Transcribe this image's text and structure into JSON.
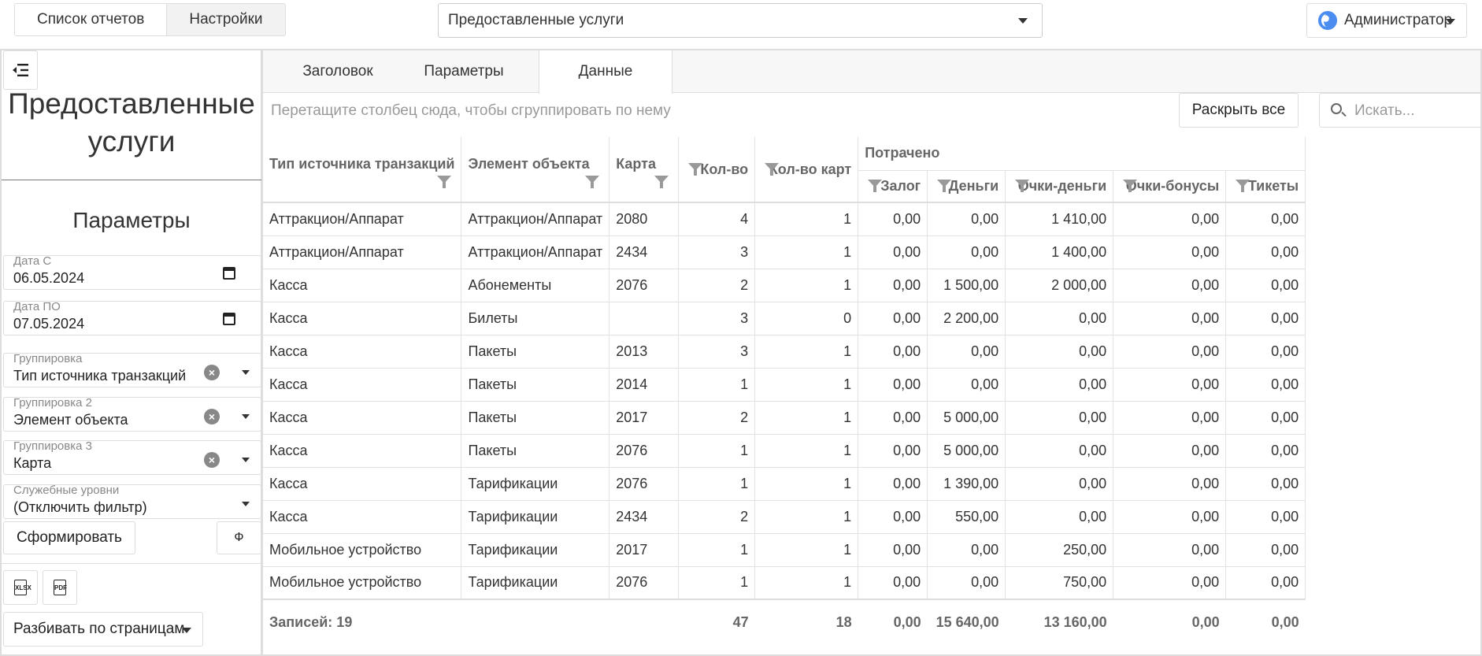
{
  "top": {
    "tabs": [
      "Список отчетов",
      "Настройки"
    ],
    "report_select": "Предоставленные услуги",
    "user": "Администратор"
  },
  "left": {
    "title": "Предоставленные услуги",
    "params_heading": "Параметры",
    "date_from": {
      "label": "Дата С",
      "value": "06.05.2024"
    },
    "date_to": {
      "label": "Дата ПО",
      "value": "07.05.2024"
    },
    "group1": {
      "label": "Группировка",
      "value": "Тип источника транзакций"
    },
    "group2": {
      "label": "Группировка 2",
      "value": "Элемент объекта"
    },
    "group3": {
      "label": "Группировка 3",
      "value": "Карта"
    },
    "service": {
      "label": "Служебные уровни",
      "value": "(Отключить фильтр)"
    },
    "generate": "Сформировать",
    "f_button": "Ф",
    "xlsx_icon": "xlsx-file-icon",
    "pdf_icon": "pdf-file-icon",
    "paging": "Разбивать по страницам"
  },
  "right": {
    "tabs": [
      "Заголовок",
      "Параметры",
      "Данные"
    ],
    "group_hint": "Перетащите столбец сюда, чтобы сгруппировать по нему",
    "expand_all": "Раскрыть все",
    "search_placeholder": "Искать...",
    "columns": {
      "source": "Тип источника транзакций",
      "element": "Элемент объекта",
      "card": "Карта",
      "qty": "Кол-во",
      "cards": "Кол-во карт",
      "spent": "Потрачено",
      "deposit": "Залог",
      "money": "Деньги",
      "pmoney": "Очки-деньги",
      "pbonus": "Очки-бонусы",
      "tickets": "Тикеты"
    },
    "rows": [
      [
        "Аттракцион/Аппарат",
        "Аттракцион/Аппарат",
        "2080",
        "4",
        "1",
        "0,00",
        "0,00",
        "1 410,00",
        "0,00",
        "0,00"
      ],
      [
        "Аттракцион/Аппарат",
        "Аттракцион/Аппарат",
        "2434",
        "3",
        "1",
        "0,00",
        "0,00",
        "1 400,00",
        "0,00",
        "0,00"
      ],
      [
        "Касса",
        "Абонементы",
        "2076",
        "2",
        "1",
        "0,00",
        "1 500,00",
        "2 000,00",
        "0,00",
        "0,00"
      ],
      [
        "Касса",
        "Билеты",
        "",
        "3",
        "0",
        "0,00",
        "2 200,00",
        "0,00",
        "0,00",
        "0,00"
      ],
      [
        "Касса",
        "Пакеты",
        "2013",
        "3",
        "1",
        "0,00",
        "0,00",
        "0,00",
        "0,00",
        "0,00"
      ],
      [
        "Касса",
        "Пакеты",
        "2014",
        "1",
        "1",
        "0,00",
        "0,00",
        "0,00",
        "0,00",
        "0,00"
      ],
      [
        "Касса",
        "Пакеты",
        "2017",
        "2",
        "1",
        "0,00",
        "5 000,00",
        "0,00",
        "0,00",
        "0,00"
      ],
      [
        "Касса",
        "Пакеты",
        "2076",
        "1",
        "1",
        "0,00",
        "5 000,00",
        "0,00",
        "0,00",
        "0,00"
      ],
      [
        "Касса",
        "Тарификации",
        "2076",
        "1",
        "1",
        "0,00",
        "1 390,00",
        "0,00",
        "0,00",
        "0,00"
      ],
      [
        "Касса",
        "Тарификации",
        "2434",
        "2",
        "1",
        "0,00",
        "550,00",
        "0,00",
        "0,00",
        "0,00"
      ],
      [
        "Мобильное устройство",
        "Тарификации",
        "2017",
        "1",
        "1",
        "0,00",
        "0,00",
        "250,00",
        "0,00",
        "0,00"
      ],
      [
        "Мобильное устройство",
        "Тарификации",
        "2076",
        "1",
        "1",
        "0,00",
        "0,00",
        "750,00",
        "0,00",
        "0,00"
      ]
    ],
    "footer": {
      "records": "Записей: 19",
      "qty": "47",
      "cards": "18",
      "deposit": "0,00",
      "money": "15 640,00",
      "pmoney": "13 160,00",
      "pbonus": "0,00",
      "tickets": "0,00"
    }
  }
}
